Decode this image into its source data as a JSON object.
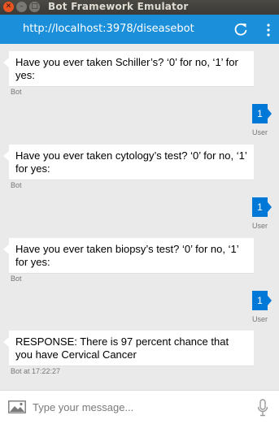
{
  "window": {
    "title": "Bot Framework Emulator",
    "close_glyph": "✕",
    "min_glyph": "–",
    "max_glyph": "□"
  },
  "address": {
    "url": "http://localhost:3978/diseasebot",
    "refresh_icon": "refresh-icon",
    "menu_icon": "more-vertical-icon"
  },
  "messages": [
    {
      "from": "bot",
      "text": "Have you ever taken Schiller’s? ‘0’ for no, ‘1’ for yes:",
      "label": "Bot"
    },
    {
      "from": "user",
      "text": "1",
      "label": "User"
    },
    {
      "from": "bot",
      "text": "Have you ever taken cytology’s test? ‘0’ for no, ‘1’ for yes:",
      "label": "Bot"
    },
    {
      "from": "user",
      "text": "1",
      "label": "User"
    },
    {
      "from": "bot",
      "text": "Have you ever taken biopsy’s test? ‘0’ for no, ‘1’ for yes:",
      "label": "Bot"
    },
    {
      "from": "user",
      "text": "1",
      "label": "User"
    },
    {
      "from": "bot",
      "text": "RESPONSE: There is 97 percent chance that you have Cervical Cancer",
      "label": "Bot at 17:22:27"
    }
  ],
  "composer": {
    "placeholder": "Type your message...",
    "image_icon": "image-upload-icon",
    "mic_icon": "microphone-icon"
  },
  "colors": {
    "title_bar": "#3b3a36",
    "url_bar": "#1b8fd9",
    "user_bubble": "#0078d7",
    "bot_bubble": "#ffffff",
    "chat_bg": "#eaeaea"
  }
}
